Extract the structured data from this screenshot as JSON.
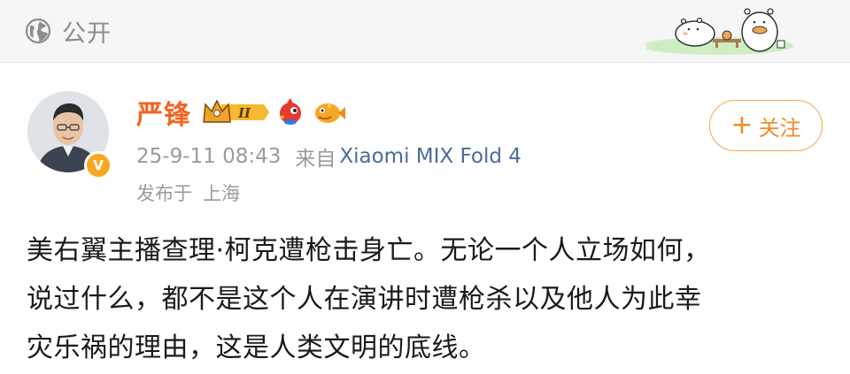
{
  "header": {
    "visibility_icon": "globe-icon",
    "visibility_label": "公开"
  },
  "post": {
    "author": {
      "name": "严锋",
      "verified_badge": "V",
      "level_badge": "II",
      "badges": [
        "crown-level-icon",
        "mascot-bird-icon",
        "mascot-fish-icon"
      ]
    },
    "timestamp": "25-9-11 08:43",
    "source_label": "来自",
    "device": "Xiaomi MIX Fold 4",
    "location_label": "发布于",
    "location": "上海",
    "follow_button": {
      "plus": "+",
      "label": "关注"
    },
    "content_lines": [
      "美右翼主播查理·柯克遭枪击身亡。无论一个人立场如何，",
      "说过什么，都不是这个人在演讲时遭枪杀以及他人为此幸",
      "灾乐祸的理由，这是人类文明的底线。"
    ]
  },
  "colors": {
    "username": "#f26522",
    "device_link": "#4b6b9a",
    "meta_gray": "#9a9a9a",
    "follow_border": "#f7a54a",
    "follow_text": "#f18a2b",
    "verified": "#f7a822"
  }
}
